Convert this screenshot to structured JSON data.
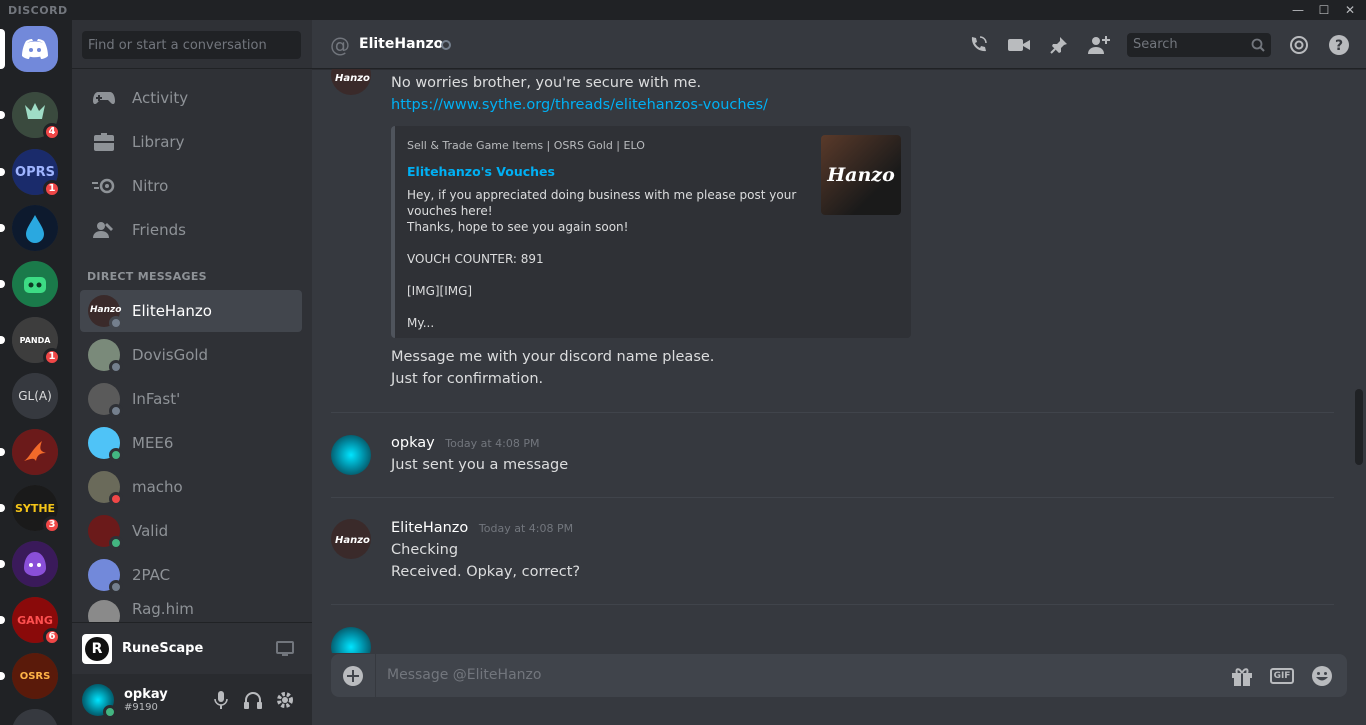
{
  "window": {
    "brand": "DISCORD",
    "minimize": "—",
    "maximize": "☐",
    "close": "✕"
  },
  "guilds": [
    {
      "label": "",
      "badge": "",
      "color": "#7289da"
    },
    {
      "label": "",
      "badge": "4",
      "color": "#3a4a3e"
    },
    {
      "label": "OPRS",
      "badge": "1",
      "color": "#1a2b6b"
    },
    {
      "label": "",
      "badge": "",
      "color": "#0d1a2e"
    },
    {
      "label": "",
      "badge": "",
      "color": "#1a7a4a"
    },
    {
      "label": "PANDA",
      "badge": "1",
      "color": "#3d3d3d"
    },
    {
      "label": "GL(A)",
      "badge": "",
      "color": "#36393f"
    },
    {
      "label": "",
      "badge": "",
      "color": "#6b1a1a"
    },
    {
      "label": "SYTHE",
      "badge": "3",
      "color": "#1a1a1a"
    },
    {
      "label": "",
      "badge": "",
      "color": "#3a1a5a"
    },
    {
      "label": "GANG",
      "badge": "6",
      "color": "#8a0a0a"
    },
    {
      "label": "OSRS",
      "badge": "",
      "color": "#5a1a0a"
    }
  ],
  "sidebar": {
    "search_placeholder": "Find or start a conversation",
    "nav": [
      {
        "label": "Activity",
        "icon": "controller-icon"
      },
      {
        "label": "Library",
        "icon": "library-icon"
      },
      {
        "label": "Nitro",
        "icon": "nitro-icon"
      },
      {
        "label": "Friends",
        "icon": "friends-icon"
      }
    ],
    "dm_header": "DIRECT MESSAGES",
    "dms": [
      {
        "name": "EliteHanzo",
        "status": "offline",
        "active": true
      },
      {
        "name": "DovisGold",
        "status": "offline",
        "active": false
      },
      {
        "name": "InFast'",
        "status": "offline",
        "active": false
      },
      {
        "name": "MEE6",
        "status": "online",
        "active": false
      },
      {
        "name": "macho",
        "status": "dnd",
        "active": false
      },
      {
        "name": "Valid",
        "status": "online",
        "active": false
      },
      {
        "name": "2PAC",
        "status": "offline",
        "active": false
      },
      {
        "name": "Rag.him",
        "status": "offline",
        "active": false
      }
    ],
    "game": {
      "name": "RuneScape"
    },
    "user": {
      "name": "opkay",
      "tag": "#9190"
    }
  },
  "header": {
    "at": "@",
    "channel": "EliteHanzo",
    "search_placeholder": "Search"
  },
  "messages": {
    "m1_line1": "No worries brother, you're secure with me.",
    "m1_link": "https://www.sythe.org/threads/elitehanzos-vouches/",
    "embed": {
      "provider": "Sell & Trade Game Items | OSRS Gold | ELO",
      "title": "Elitehanzo's Vouches",
      "desc1": "Hey, if you appreciated doing business with me please post your",
      "desc2": "vouches here!",
      "desc3": "Thanks, hope to see you again soon!",
      "desc4": "VOUCH COUNTER: 891",
      "desc5": "[IMG][IMG]",
      "desc6": "My...",
      "thumb_text": "Hanzo"
    },
    "m1_line2": "Message me with your discord name please.",
    "m1_line3": "Just for confirmation.",
    "m2_author": "opkay",
    "m2_time": "Today at 4:08 PM",
    "m2_line1": "Just sent you a message",
    "m3_author": "EliteHanzo",
    "m3_time": "Today at 4:08 PM",
    "m3_line1": "Checking",
    "m3_line2": "Received. Opkay, correct?"
  },
  "composer": {
    "placeholder": "Message @EliteHanzo",
    "gif": "GIF"
  },
  "colors": {
    "accent": "#7289da",
    "link": "#00b0f4",
    "online": "#43b581",
    "dnd": "#f04747",
    "offline": "#747f8d"
  }
}
